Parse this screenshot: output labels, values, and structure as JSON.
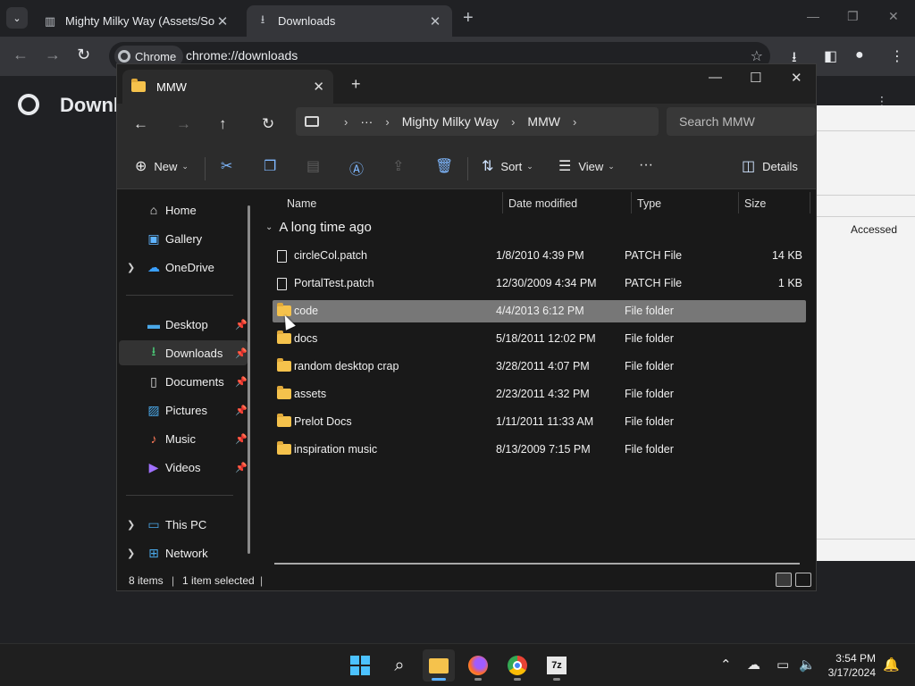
{
  "chrome": {
    "tabs": [
      {
        "title": "Mighty Milky Way (Assets/Sounds)",
        "icon": "github-icon"
      },
      {
        "title": "Downloads",
        "icon": "download-icon"
      }
    ],
    "omnibox": {
      "chip_label": "Chrome",
      "url": "chrome://downloads"
    },
    "page_title": "Downloads"
  },
  "background_window": {
    "column_label": "Accessed"
  },
  "explorer": {
    "tab_title": "MMW",
    "breadcrumb": {
      "ellipsis": "···",
      "items": [
        "Mighty Milky Way",
        "MMW"
      ]
    },
    "search_placeholder": "Search MMW",
    "commands": {
      "new": "New",
      "sort": "Sort",
      "view": "View",
      "more": "···",
      "details": "Details"
    },
    "nav": {
      "home": "Home",
      "gallery": "Gallery",
      "onedrive": "OneDrive",
      "desktop": "Desktop",
      "downloads": "Downloads",
      "documents": "Documents",
      "pictures": "Pictures",
      "music": "Music",
      "videos": "Videos",
      "thispc": "This PC",
      "network": "Network"
    },
    "columns": {
      "name": "Name",
      "date": "Date modified",
      "type": "Type",
      "size": "Size"
    },
    "group": "A long time ago",
    "files": [
      {
        "name": "circleCol.patch",
        "date": "1/8/2010 4:39 PM",
        "type": "PATCH File",
        "size": "14 KB",
        "kind": "file"
      },
      {
        "name": "PortalTest.patch",
        "date": "12/30/2009 4:34 PM",
        "type": "PATCH File",
        "size": "1 KB",
        "kind": "file"
      },
      {
        "name": "code",
        "date": "4/4/2013 6:12 PM",
        "type": "File folder",
        "size": "",
        "kind": "folder"
      },
      {
        "name": "docs",
        "date": "5/18/2011 12:02 PM",
        "type": "File folder",
        "size": "",
        "kind": "folder"
      },
      {
        "name": "random desktop crap",
        "date": "3/28/2011 4:07 PM",
        "type": "File folder",
        "size": "",
        "kind": "folder"
      },
      {
        "name": "assets",
        "date": "2/23/2011 4:32 PM",
        "type": "File folder",
        "size": "",
        "kind": "folder"
      },
      {
        "name": "Prelot Docs",
        "date": "1/11/2011 11:33 AM",
        "type": "File folder",
        "size": "",
        "kind": "folder"
      },
      {
        "name": "inspiration music",
        "date": "8/13/2009 7:15 PM",
        "type": "File folder",
        "size": "",
        "kind": "folder"
      }
    ],
    "status": {
      "count": "8 items",
      "selected": "1 item selected"
    }
  },
  "taskbar": {
    "time": "3:54 PM",
    "date": "3/17/2024",
    "apps": [
      "windows-start",
      "search",
      "file-explorer",
      "firefox",
      "chrome",
      "7zip"
    ],
    "sevenzip_label": "7z"
  }
}
